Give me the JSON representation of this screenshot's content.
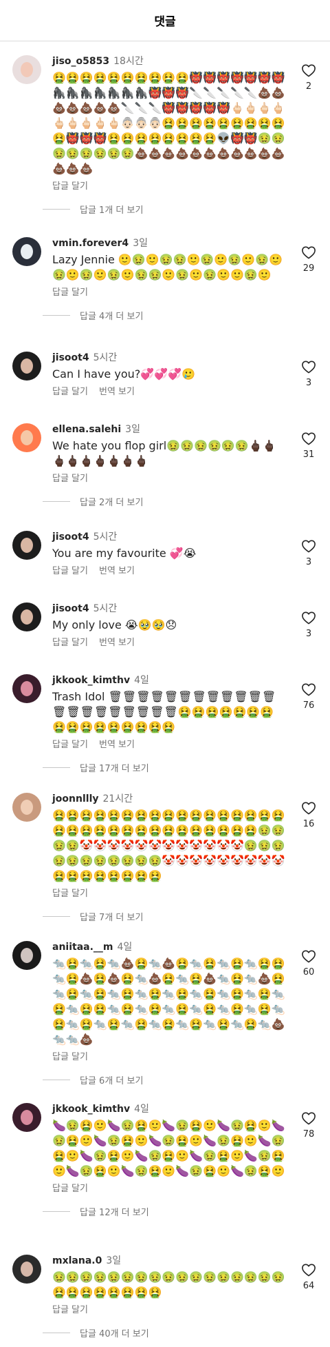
{
  "header": {
    "title": "댓글"
  },
  "comments": [
    {
      "username": "jiso_o5853",
      "time": "18시간",
      "text": "🤮🤮🤮🤮🤮🤮🤮🤮🤮🤮👹👹👹👹👹👹👹🦍🦍🦍🦍🦍🦍🦍👹👹👹🔪🔪🔪🔪🔪💩💩💩💩💩💩💩🔪🔪🔪👹👹👹👹👹🖕🏻🖕🏻🖕🏻🖕🏻🖕🏻🖕🏻🖕🏻🖕🏻🖕🏻👵🏻👵🏻👵🏻🤮🤮🤮🤮🤮🤮🤮🤮🤮🤮👹👹👹🤮🤮🤮🤮🤮🤮🤮🤮👽👹👹🤢🤢🤢🤢🤢🤢🤢🤢💩💩💩💩💩💩💩💩💩💩💩💩💩💩",
      "reply": "답글 달기",
      "translate": "",
      "likes": "2",
      "more": "답글 1개 더 보기",
      "avatar": {
        "bg": "#e9dede",
        "face": "#f2c9b8"
      }
    },
    {
      "username": "vmin.forever4",
      "time": "3일",
      "text": "Lazy Jennie 🙂🤢🙂🤢🤢🙂🤢🙂🤢🙂🤢🙂🤢🙂🤢🙂🤢🙂🤢🤢🙂🤢🙂🤢🙂🙂🤢🙂",
      "reply": "답글 달기",
      "translate": "",
      "likes": "29",
      "more": "답글 4개 더 보기",
      "avatar": {
        "bg": "#2a2f3a",
        "face": "#e9eef2"
      }
    },
    {
      "username": "jisoot4",
      "time": "5시간",
      "text": "Can I have you?💞💞💞🥲",
      "reply": "답글 달기",
      "translate": "번역 보기",
      "likes": "3",
      "more": "",
      "avatar": {
        "bg": "#1d1d1d",
        "face": "#d9b7a4"
      }
    },
    {
      "username": "ellena.salehi",
      "time": "3일",
      "text": "We hate you flop girl🤢🤢🤢🤢🤢🤢🖕🏿🖕🏿🖕🏿🖕🏿🖕🏿🖕🏿🖕🏿🖕🏿🖕🏿",
      "reply": "답글 달기",
      "translate": "",
      "likes": "31",
      "more": "답글 2개 더 보기",
      "avatar": {
        "bg": "#ff7a4d",
        "face": "#f5c7a6"
      }
    },
    {
      "username": "jisoot4",
      "time": "5시간",
      "text": "You are my favourite 💞😭",
      "reply": "답글 달기",
      "translate": "번역 보기",
      "likes": "3",
      "more": "",
      "avatar": {
        "bg": "#1d1d1d",
        "face": "#d9b7a4"
      }
    },
    {
      "username": "jisoot4",
      "time": "5시간",
      "text": "My only love 😭🥹🥹😞",
      "reply": "답글 달기",
      "translate": "번역 보기",
      "likes": "3",
      "more": "",
      "avatar": {
        "bg": "#1d1d1d",
        "face": "#d9b7a4"
      }
    },
    {
      "username": "jkkook_kimthv",
      "time": "4일",
      "text": "Trash Idol 🗑🗑🗑🗑🗑🗑🗑🗑🗑🗑🗑🗑🗑🗑🗑🗑🗑🗑🗑🗑🗑🤮🤮🤮🤮🤮🤮🤮🤮🤮🤮🤮🤮🤮🤮🤮🤮",
      "reply": "답글 달기",
      "translate": "번역 보기",
      "likes": "76",
      "more": "답글 17개 더 보기",
      "avatar": {
        "bg": "#3a1d2c",
        "face": "#d88b9e"
      }
    },
    {
      "username": "joonnllly",
      "time": "21시간",
      "text": "🤮🤮🤮🤮🤮🤮🤮🤮🤮🤮🤮🤮🤮🤮🤮🤮🤮🤮🤮🤮🤮🤮🤮🤮🤮🤮🤮🤮🤮🤮🤮🤮🤢🤢🤢🤢🤡🤡🤡🤡🤡🤡🤡🤡🤡🤡🤡🤡🤢🤢🤢🤢🤢🤢🤢🤢🤢🤢🤢🤡🤡🤡🤡🤡🤡🤡🤡🤡🤮🤮🤮🤮🤮🤮🤮🤮",
      "reply": "답글 달기",
      "translate": "",
      "likes": "16",
      "more": "답글 7개 더 보기",
      "avatar": {
        "bg": "#c99a7e",
        "face": "#f0cdb5"
      }
    },
    {
      "username": "aniitaa.__m",
      "time": "4일",
      "text": "🐀🤮🐀🤮🐀💩🤮🐀💩🤮🐀🤮🐀🤮🐀🤮🤮🐀🤮💩🤮💩🤮🐀💩🤮🐀🤮💩🐀🤮🐀💩🤮🐀🤮🐀🤮🐀🤮🐀🤮🐀🤮🐀🤮🐀🤮🐀🤮🐀🤮🐀🤮🤮🐀🤮🐀🤮🐀🤮🐀🤮🐀🤮🐀🤮🐀🤮🐀🤮🐀🤮🐀🤮🐀🤮🐀🤮🐀🤮🐀🤮🐀💩🐀🐀💩",
      "reply": "답글 달기",
      "translate": "",
      "likes": "60",
      "more": "답글 6개 더 보기",
      "avatar": {
        "bg": "#1a1a1a",
        "face": "#cfc4c0"
      }
    },
    {
      "username": "jkkook_kimthv",
      "time": "4일",
      "text": "🍆🤢🤮🙂🍆🤢🤮🙂🍆🤢🤮🙂🍆🤢🤮🙂🍆🤢🤮🙂🍆🤢🤮🙂🍆🤢🤮🙂🍆🤢🤮🙂🍆🤢🤮🙂🍆🤢🤮🙂🍆🤢🤮🙂🍆🤢🤮🙂🍆🤢🤮🙂🍆🤢🤮🙂🍆🤢🤮🙂🍆🤢🤮🙂🍆🤢🤮🙂",
      "reply": "답글 달기",
      "translate": "",
      "likes": "78",
      "more": "답글 12개 더 보기",
      "avatar": {
        "bg": "#3a1d2c",
        "face": "#d88b9e"
      }
    },
    {
      "username": "mxlana.0",
      "time": "3일",
      "text": "🤢🤢🤢🤢🤢🤢🤢🤢🤢🤢🤢🤢🤢🤢🤢🤢🤢🤮🤮🤮🤮🤮🤮🤮🤮",
      "reply": "답글 달기",
      "translate": "",
      "likes": "64",
      "more": "답글 40개 더 보기",
      "avatar": {
        "bg": "#2b2b2b",
        "face": "#d6b7a9"
      }
    }
  ]
}
